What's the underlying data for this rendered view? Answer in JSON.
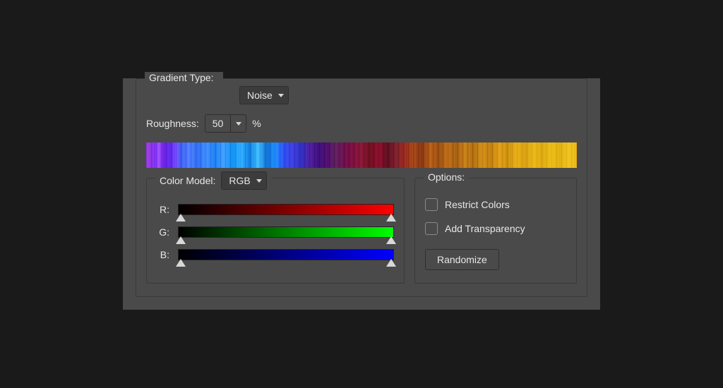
{
  "gradient": {
    "type_label": "Gradient Type:",
    "type_value": "Noise",
    "roughness_label": "Roughness:",
    "roughness_value": "50",
    "roughness_unit": "%"
  },
  "colorModel": {
    "legend": "Color Model:",
    "value": "RGB",
    "channels": {
      "r": "R:",
      "g": "G:",
      "b": "B:"
    }
  },
  "options": {
    "legend": "Options:",
    "restrict": "Restrict Colors",
    "transparency": "Add Transparency",
    "randomize": "Randomize"
  }
}
